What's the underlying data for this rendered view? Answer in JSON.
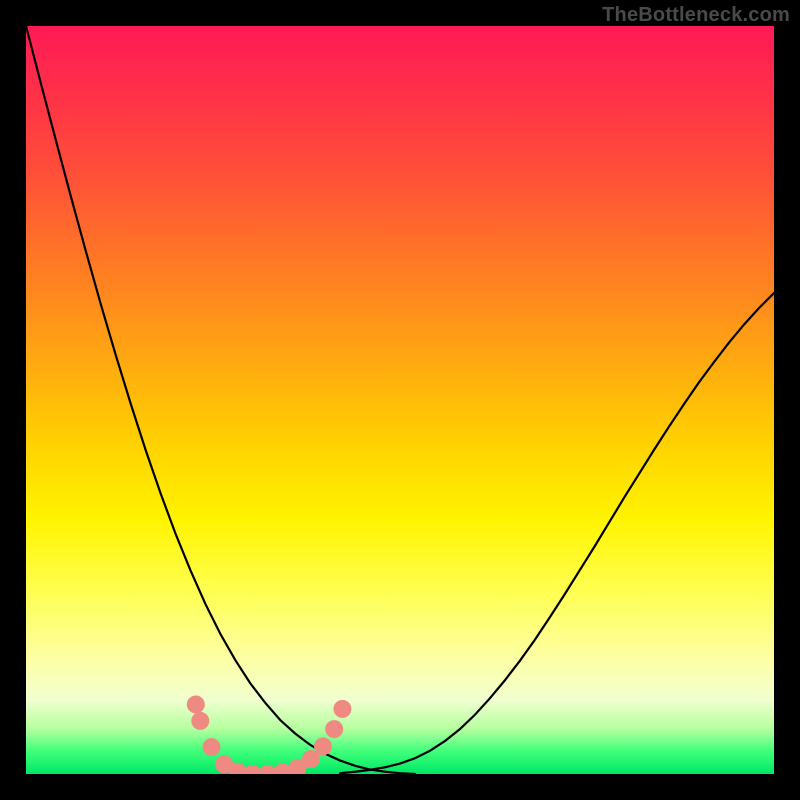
{
  "watermark": "TheBottleneck.com",
  "colors": {
    "frame": "#000000",
    "curve": "#000000",
    "marker": "#ef8a82",
    "gradient_stops": [
      "#ff1a55",
      "#ff2e4a",
      "#ff5038",
      "#ff7a24",
      "#ffa612",
      "#ffd200",
      "#fff400",
      "#ffff55",
      "#fdffa0",
      "#f2ffcf",
      "#b4ff9f",
      "#3eff7a",
      "#00e865"
    ]
  },
  "chart_data": {
    "type": "line",
    "title": "",
    "xlabel": "",
    "ylabel": "",
    "xlim": [
      0,
      100
    ],
    "ylim": [
      0,
      100
    ],
    "x": [
      0,
      2,
      4,
      6,
      8,
      10,
      12,
      14,
      16,
      18,
      20,
      22,
      24,
      26,
      28,
      30,
      32,
      34,
      36,
      38,
      40,
      42,
      44,
      46,
      48,
      50,
      52,
      54,
      56,
      58,
      60,
      62,
      64,
      66,
      68,
      70,
      72,
      74,
      76,
      78,
      80,
      82,
      84,
      86,
      88,
      90,
      92,
      94,
      96,
      98,
      100
    ],
    "series": [
      {
        "name": "left-curve",
        "values": [
          100,
          92.3,
          84.7,
          77.2,
          69.9,
          62.8,
          56.0,
          49.5,
          43.3,
          37.5,
          32.1,
          27.2,
          22.7,
          18.7,
          15.2,
          12.1,
          9.5,
          7.2,
          5.4,
          3.9,
          2.7,
          1.8,
          1.1,
          0.6,
          0.3,
          0.1,
          0,
          0,
          0,
          0,
          0,
          0,
          0,
          0,
          0,
          0,
          0,
          0,
          0,
          0,
          0,
          0,
          0,
          0,
          0,
          0,
          0,
          0,
          0,
          0,
          0
        ]
      },
      {
        "name": "right-curve",
        "values": [
          0,
          0,
          0,
          0,
          0,
          0,
          0,
          0,
          0,
          0,
          0,
          0,
          0,
          0,
          0,
          0,
          0,
          0,
          0,
          0,
          0,
          0.1,
          0.3,
          0.55,
          0.9,
          1.4,
          2.1,
          3.1,
          4.4,
          6.0,
          7.9,
          10.1,
          12.5,
          15.1,
          17.9,
          20.9,
          24.0,
          27.2,
          30.4,
          33.7,
          37.0,
          40.2,
          43.4,
          46.5,
          49.5,
          52.4,
          55.1,
          57.7,
          60.1,
          62.3,
          64.3
        ]
      }
    ],
    "markers": {
      "name": "highlight-dots",
      "color": "#ef8a82",
      "points": [
        {
          "x": 22.7,
          "y": 9.3
        },
        {
          "x": 23.3,
          "y": 7.1
        },
        {
          "x": 24.8,
          "y": 3.6
        },
        {
          "x": 26.5,
          "y": 1.3
        },
        {
          "x": 28.3,
          "y": 0.3
        },
        {
          "x": 30.3,
          "y": 0.0
        },
        {
          "x": 32.3,
          "y": 0.0
        },
        {
          "x": 34.3,
          "y": 0.2
        },
        {
          "x": 36.3,
          "y": 0.8
        },
        {
          "x": 38.1,
          "y": 2.0
        },
        {
          "x": 39.7,
          "y": 3.7
        },
        {
          "x": 41.2,
          "y": 6.0
        },
        {
          "x": 42.3,
          "y": 8.7
        }
      ]
    }
  }
}
